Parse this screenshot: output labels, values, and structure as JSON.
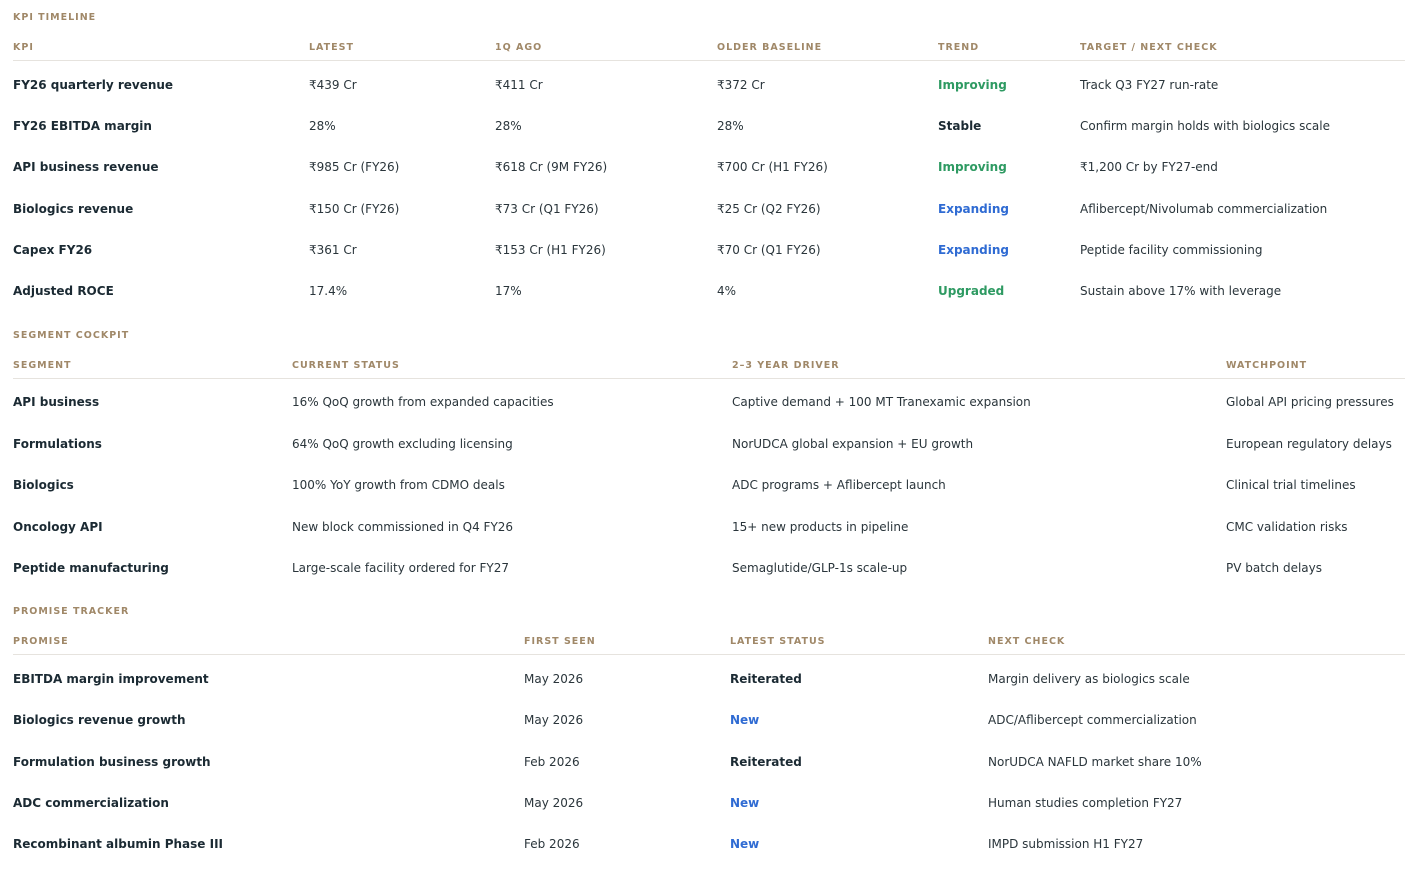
{
  "kpi": {
    "title": "KPI TIMELINE",
    "headers": [
      "KPI",
      "LATEST",
      "1Q AGO",
      "OLDER BASELINE",
      "TREND",
      "TARGET / NEXT CHECK"
    ],
    "rows": [
      [
        "FY26 quarterly revenue",
        "₹439 Cr",
        "₹411 Cr",
        "₹372 Cr",
        "Improving",
        "Track Q3 FY27 run-rate"
      ],
      [
        "FY26 EBITDA margin",
        "28%",
        "28%",
        "28%",
        "Stable",
        "Confirm margin holds with biologics scale"
      ],
      [
        "API business revenue",
        "₹985 Cr (FY26)",
        "₹618 Cr (9M FY26)",
        "₹700 Cr (H1 FY26)",
        "Improving",
        "₹1,200 Cr by FY27-end"
      ],
      [
        "Biologics revenue",
        "₹150 Cr (FY26)",
        "₹73 Cr (Q1 FY26)",
        "₹25 Cr (Q2 FY26)",
        "Expanding",
        "Aflibercept/Nivolumab commercialization"
      ],
      [
        "Capex FY26",
        "₹361 Cr",
        "₹153 Cr (H1 FY26)",
        "₹70 Cr (Q1 FY26)",
        "Expanding",
        "Peptide facility commissioning"
      ],
      [
        "Adjusted ROCE",
        "17.4%",
        "17%",
        "4%",
        "Upgraded",
        "Sustain above 17% with leverage"
      ]
    ]
  },
  "segments": {
    "title": "SEGMENT COCKPIT",
    "headers": [
      "SEGMENT",
      "CURRENT STATUS",
      "2–3 YEAR DRIVER",
      "WATCHPOINT"
    ],
    "rows": [
      [
        "API business",
        "16% QoQ growth from expanded capacities",
        "Captive demand + 100 MT Tranexamic expansion",
        "Global API pricing pressures"
      ],
      [
        "Formulations",
        "64% QoQ growth excluding licensing",
        "NorUDCA global expansion + EU growth",
        "European regulatory delays"
      ],
      [
        "Biologics",
        "100% YoY growth from CDMO deals",
        "ADC programs + Aflibercept launch",
        "Clinical trial timelines"
      ],
      [
        "Oncology API",
        "New block commissioned in Q4 FY26",
        "15+ new products in pipeline",
        "CMC validation risks"
      ],
      [
        "Peptide manufacturing",
        "Large-scale facility ordered for FY27",
        "Semaglutide/GLP-1s scale-up",
        "PV batch delays"
      ]
    ]
  },
  "promises": {
    "title": "PROMISE TRACKER",
    "headers": [
      "PROMISE",
      "FIRST SEEN",
      "LATEST STATUS",
      "NEXT CHECK"
    ],
    "rows": [
      [
        "EBITDA margin improvement",
        "May 2026",
        "Reiterated",
        "Margin delivery as biologics scale"
      ],
      [
        "Biologics revenue growth",
        "May 2026",
        "New",
        "ADC/Aflibercept commercialization"
      ],
      [
        "Formulation business growth",
        "Feb 2026",
        "Reiterated",
        "NorUDCA NAFLD market share 10%"
      ],
      [
        "ADC commercialization",
        "May 2026",
        "New",
        "Human studies completion FY27"
      ],
      [
        "Recombinant albumin Phase III",
        "Feb 2026",
        "New",
        "IMPD submission H1 FY27"
      ]
    ]
  },
  "status_colors": {
    "Improving": "#2e9a62",
    "Upgraded": "#2e9a62",
    "Expanding": "#2f6bd3",
    "New": "#2f6bd3",
    "Stable": "#1b2a33",
    "Reiterated": "#1b2a33"
  }
}
